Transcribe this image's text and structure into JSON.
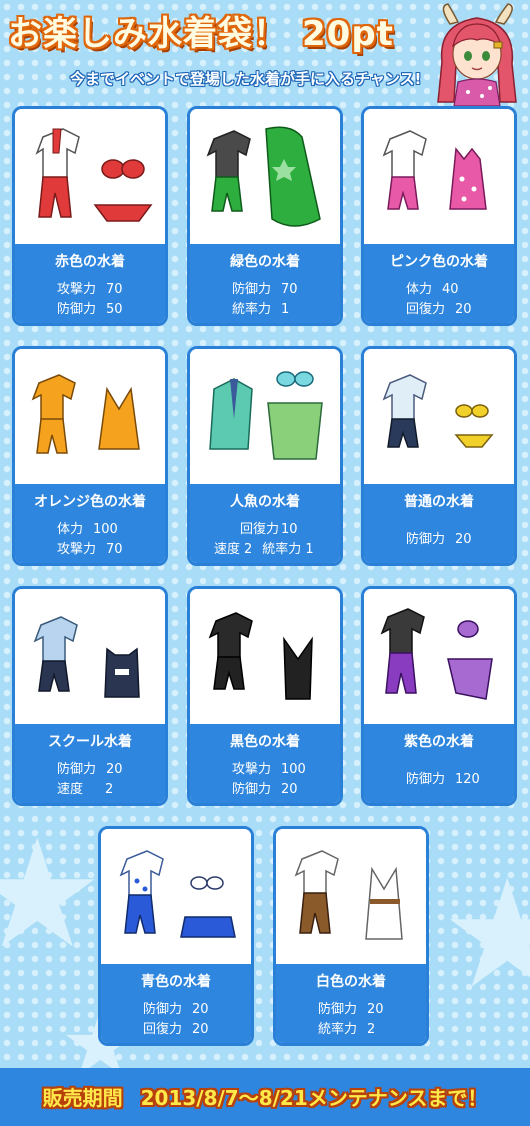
{
  "header": {
    "title": "お楽しみ水着袋！",
    "price": "20pt",
    "subtitle": "今までイベントで登場した水着が手に入るチャンス!"
  },
  "items": [
    {
      "name": "赤色の水着",
      "icon": "red-swimsuit-icon",
      "color": "#e03a3a",
      "stats": [
        {
          "label": "攻撃力",
          "value": "70"
        },
        {
          "label": "防御力",
          "value": "50"
        }
      ]
    },
    {
      "name": "緑色の水着",
      "icon": "green-swimsuit-icon",
      "color": "#2eae3e",
      "stats": [
        {
          "label": "防御力",
          "value": "70"
        },
        {
          "label": "統率力",
          "value": "1"
        }
      ]
    },
    {
      "name": "ピンク色の水着",
      "icon": "pink-swimsuit-icon",
      "color": "#e85aa8",
      "stats": [
        {
          "label": "体力",
          "value": "40"
        },
        {
          "label": "回復力",
          "value": "20"
        }
      ]
    },
    {
      "name": "オレンジ色の水着",
      "icon": "orange-swimsuit-icon",
      "color": "#f5a21e",
      "stats": [
        {
          "label": "体力",
          "value": "100"
        },
        {
          "label": "攻撃力",
          "value": "70"
        }
      ]
    },
    {
      "name": "人魚の水着",
      "icon": "mermaid-swimsuit-icon",
      "color": "#5ccab0",
      "stats": [
        {
          "label": "回復力",
          "value": "10"
        },
        {
          "label": "速度",
          "value": "2"
        },
        {
          "label": "統率力",
          "value": "1"
        }
      ]
    },
    {
      "name": "普通の水着",
      "icon": "normal-swimsuit-icon",
      "color": "#2a3a5a",
      "stats": [
        {
          "label": "防御力",
          "value": "20"
        }
      ]
    },
    {
      "name": "スクール水着",
      "icon": "school-swimsuit-icon",
      "color": "#2a3552",
      "stats": [
        {
          "label": "防御力",
          "value": "20"
        },
        {
          "label": "速度",
          "value": "2"
        }
      ]
    },
    {
      "name": "黒色の水着",
      "icon": "black-swimsuit-icon",
      "color": "#222222",
      "stats": [
        {
          "label": "攻撃力",
          "value": "100"
        },
        {
          "label": "防御力",
          "value": "20"
        }
      ]
    },
    {
      "name": "紫色の水着",
      "icon": "purple-swimsuit-icon",
      "color": "#8a3cc0",
      "stats": [
        {
          "label": "防御力",
          "value": "120"
        }
      ]
    },
    {
      "name": "青色の水着",
      "icon": "blue-swimsuit-icon",
      "color": "#2a5ad8",
      "stats": [
        {
          "label": "防御力",
          "value": "20"
        },
        {
          "label": "回復力",
          "value": "20"
        }
      ]
    },
    {
      "name": "白色の水着",
      "icon": "white-swimsuit-icon",
      "color": "#8a5a2a",
      "stats": [
        {
          "label": "防御力",
          "value": "20"
        },
        {
          "label": "統率力",
          "value": "2"
        }
      ]
    }
  ],
  "footer": {
    "label": "販売期間",
    "period": "2013/8/7〜8/21メンテナンスまで！"
  }
}
